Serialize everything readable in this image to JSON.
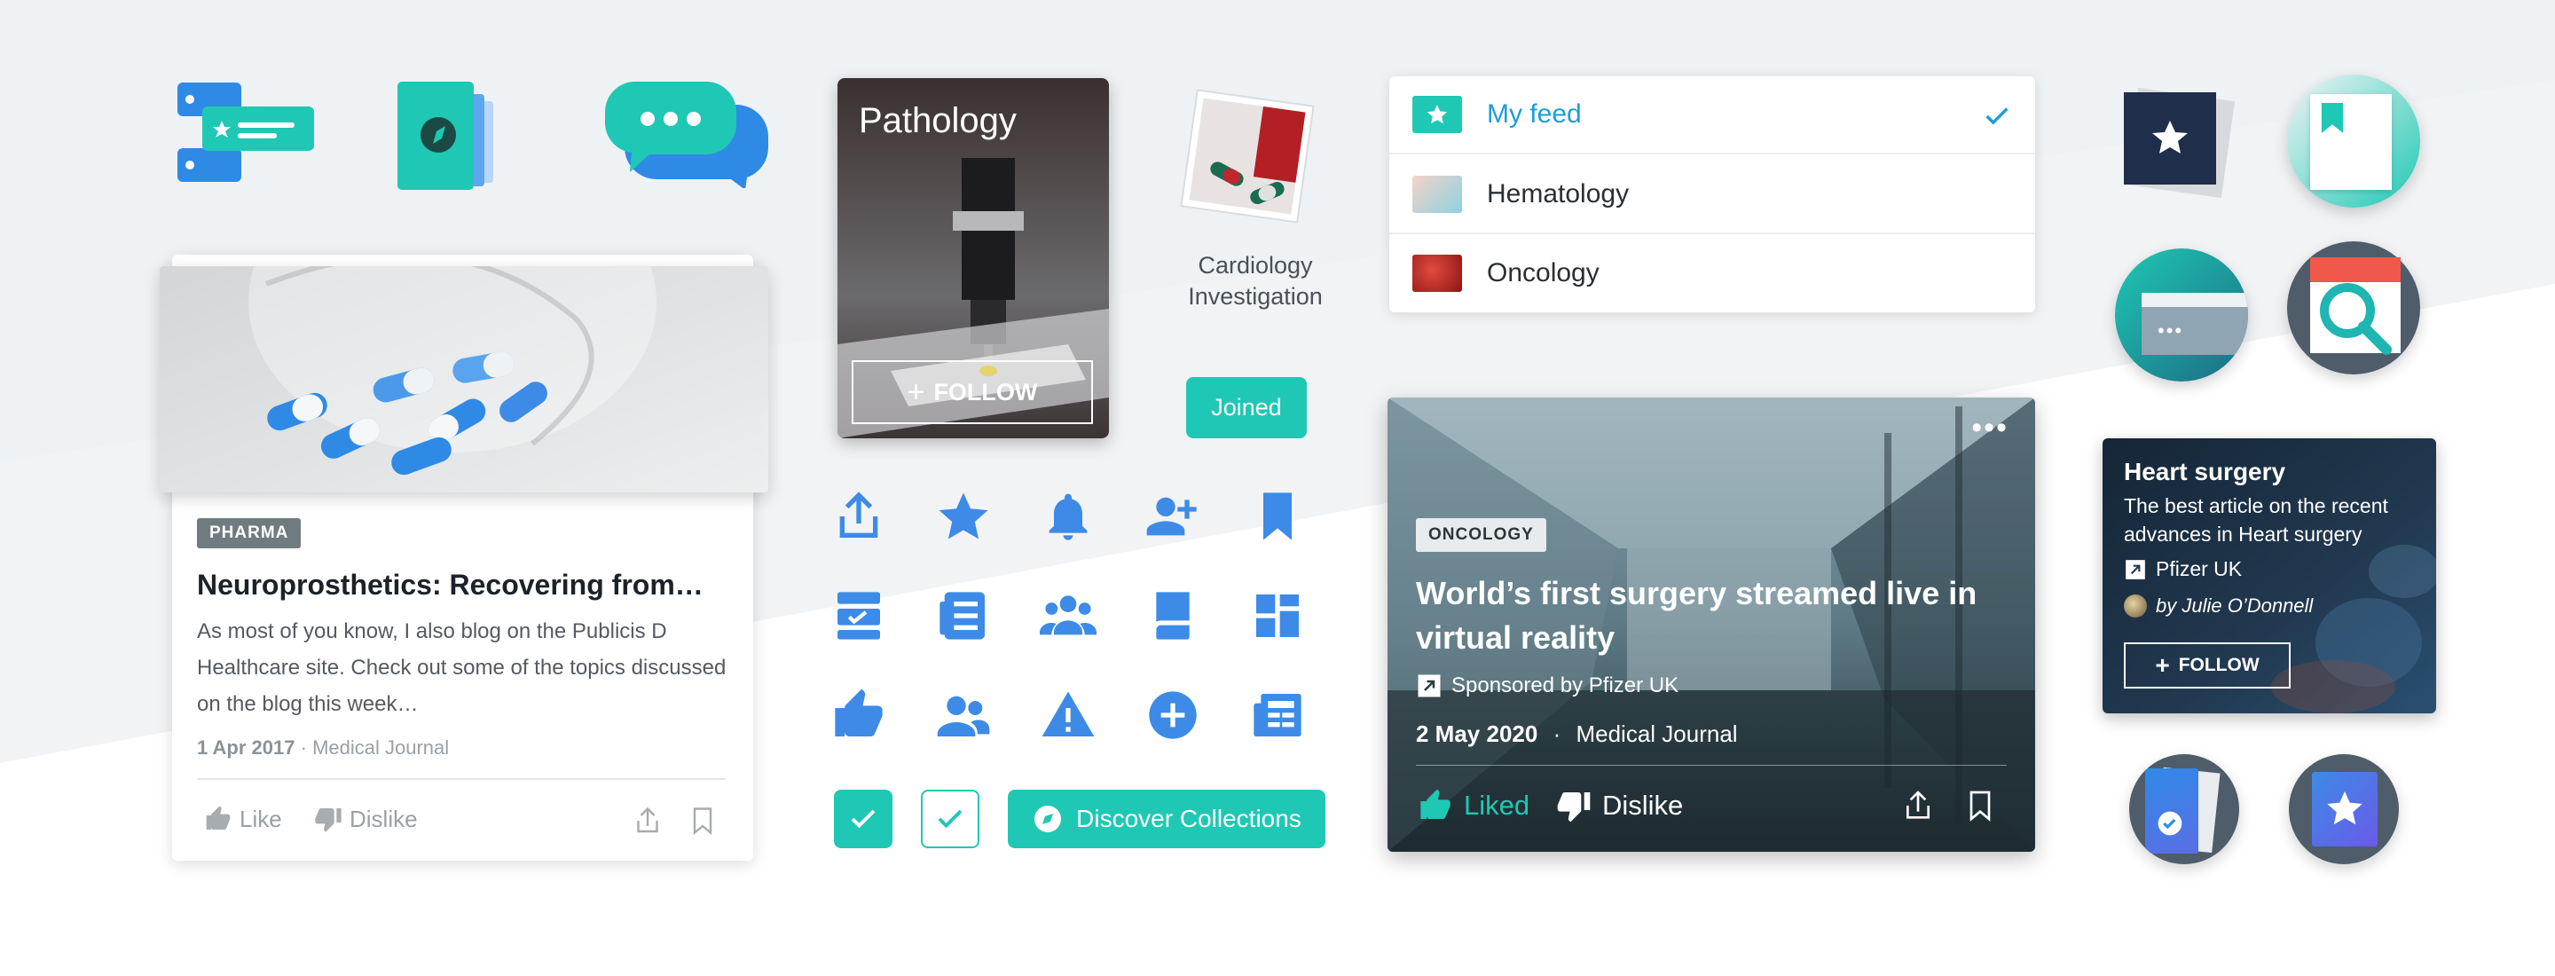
{
  "colors": {
    "accent_teal": "#1fc8b4",
    "accent_blue": "#3d8be6",
    "feed_active": "#1e9cd8",
    "text_dark": "#1c2229",
    "muted": "#9aa0a5"
  },
  "article_card": {
    "tag": "PHARMA",
    "title": "Neuroprosthetics: Recovering from…",
    "body_line1": "As most of you know, I also blog on the Publicis D",
    "body_line2": "Healthcare site. Check out some of the topics discussed",
    "body_line3": "on the blog this week…",
    "date": "1 Apr 2017",
    "separator": "·",
    "source": "Medical Journal",
    "like_label": "Like",
    "dislike_label": "Dislike",
    "icons": [
      "thumb-up-icon",
      "thumb-down-icon",
      "share-icon",
      "bookmark-icon"
    ]
  },
  "pathology_card": {
    "title": "Pathology",
    "follow_label": "FOLLOW"
  },
  "cardiology": {
    "line1": "Cardiology",
    "line2": "Investigation",
    "joined_label": "Joined"
  },
  "icon_grid": [
    "share-icon",
    "star-icon",
    "bell-icon",
    "add-user-icon",
    "bookmark-icon",
    "inbox-icon",
    "news-list-icon",
    "group-icon",
    "book-icon",
    "dashboard-icon",
    "thumb-up-icon",
    "users-icon",
    "warning-icon",
    "add-circle-icon",
    "newspaper-icon"
  ],
  "discover_button": {
    "label": "Discover Collections"
  },
  "feed": {
    "items": [
      {
        "label": "My feed",
        "active": true
      },
      {
        "label": "Hematology",
        "active": false
      },
      {
        "label": "Oncology",
        "active": false
      }
    ]
  },
  "hero_card": {
    "tag": "ONCOLOGY",
    "title_line1": "World’s first surgery streamed live in",
    "title_line2": "virtual reality",
    "sponsor": "Sponsored by Pfizer UK",
    "date": "2 May 2020",
    "separator": "·",
    "source": "Medical Journal",
    "liked_label": "Liked",
    "dislike_label": "Dislike"
  },
  "heart_card": {
    "title": "Heart surgery",
    "desc_line1": "The best article on the recent",
    "desc_line2": "advances in Heart surgery",
    "source": "Pfizer UK",
    "author": "by Julie O’Donnell",
    "follow_label": "FOLLOW"
  }
}
